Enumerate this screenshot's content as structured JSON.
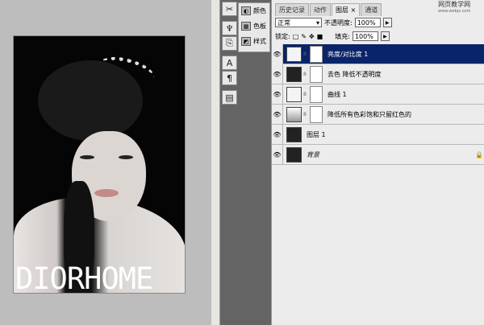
{
  "canvas": {
    "watermark": "DIORHOME"
  },
  "tools": [
    "tool-preset-icon",
    "brush-icon",
    "clone-source-icon",
    "character-icon",
    "paragraph-icon",
    "layer-comps-icon"
  ],
  "mini_panels": [
    {
      "label": "颜色",
      "icon": "color-icon"
    },
    {
      "label": "色板",
      "icon": "swatches-icon"
    },
    {
      "label": "样式",
      "icon": "styles-icon"
    }
  ],
  "layers_panel": {
    "tabs": [
      {
        "label": "历史记录"
      },
      {
        "label": "动作"
      },
      {
        "label": "图层 ×",
        "active": true
      },
      {
        "label": "通道"
      }
    ],
    "site": {
      "name": "网页教学网",
      "url": "www.webjx.com"
    },
    "blend_mode": "正常",
    "opacity_label": "不透明度:",
    "opacity": "100%",
    "lock_label": "锁定:",
    "fill_label": "填充:",
    "fill": "100%",
    "selected_color": "#0a246a",
    "layers": [
      {
        "name": "亮度/对比度 1",
        "type": "adjustment",
        "selected": true
      },
      {
        "name": "去色 降低不透明度",
        "type": "image-mask"
      },
      {
        "name": "曲线 1",
        "type": "adjustment"
      },
      {
        "name": "降低所有色彩饱和只留红色的",
        "type": "adjustment"
      },
      {
        "name": "图层 1",
        "type": "image"
      },
      {
        "name": "背景",
        "type": "background",
        "locked": true
      }
    ]
  }
}
